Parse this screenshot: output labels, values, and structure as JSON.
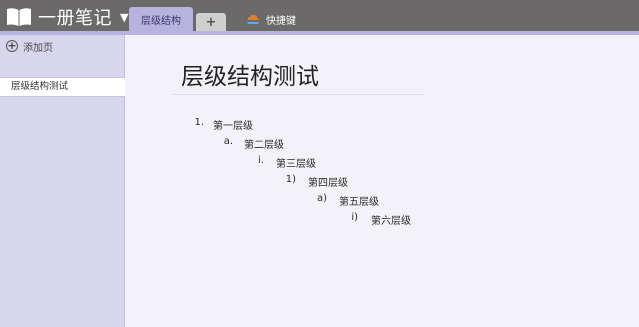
{
  "app": {
    "notebook_name": "一册笔记",
    "notebook_icon": "book-icon",
    "dropdown_icon": "caret-down-icon",
    "colors": {
      "topbar": "#6b6969",
      "accent": "#b7b2de",
      "sidebar": "#d8d6ec",
      "content": "#f3f2f8"
    }
  },
  "tabs": {
    "active_label": "层级结构",
    "add_label": "+",
    "shortcut_label": "快捷键",
    "shortcut_icon": "cloud-icon"
  },
  "sidebar": {
    "add_page_label": "添加页",
    "add_page_icon": "plus-circle-icon",
    "pages": [
      {
        "label": "层级结构测试",
        "selected": true
      }
    ]
  },
  "page": {
    "title": "层级结构测试",
    "outline": [
      {
        "level": 1,
        "marker": "1.",
        "text": "第一层级"
      },
      {
        "level": 2,
        "marker": "a.",
        "text": "第二层级"
      },
      {
        "level": 3,
        "marker": "i.",
        "text": "第三层级"
      },
      {
        "level": 4,
        "marker": "1)",
        "text": "第四层级"
      },
      {
        "level": 5,
        "marker": "a)",
        "text": "第五层级"
      },
      {
        "level": 6,
        "marker": "i)",
        "text": "第六层级"
      }
    ]
  }
}
